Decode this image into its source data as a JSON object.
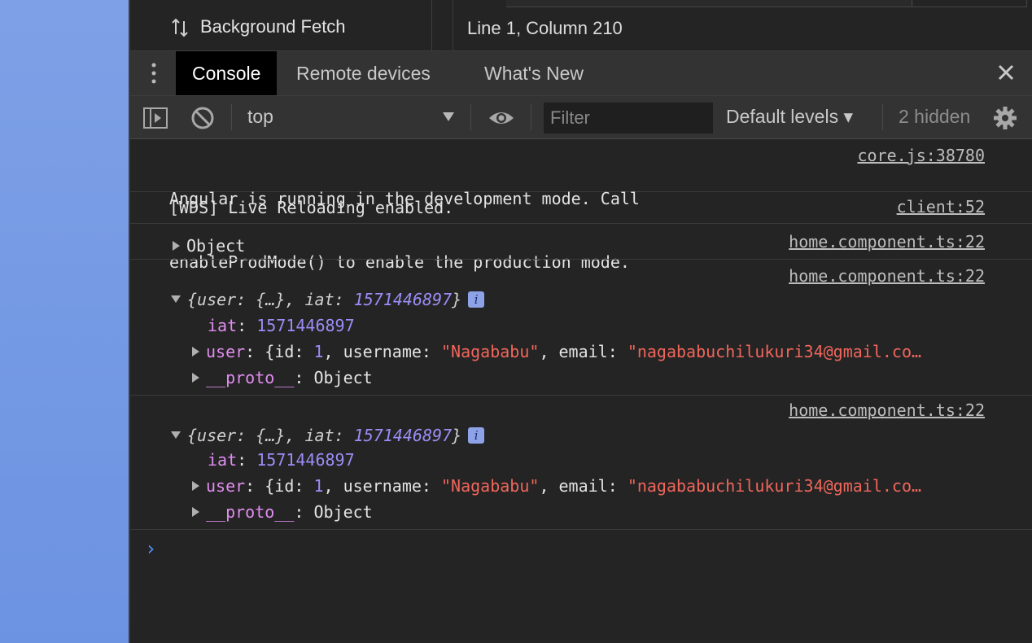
{
  "application_panel": {
    "item_label": "Background Fetch",
    "icon": "up-down-arrows-icon"
  },
  "source_status": "Line 1, Column 210",
  "drawer": {
    "tabs": [
      {
        "label": "Console",
        "active": true
      },
      {
        "label": "Remote devices",
        "active": false
      },
      {
        "label": "What's New",
        "active": false
      }
    ]
  },
  "toolbar": {
    "context": "top",
    "filter_placeholder": "Filter",
    "levels": "Default levels ▾",
    "hidden": "2 hidden"
  },
  "messages": {
    "m1": {
      "line1": "Angular is running in the development mode. Call",
      "line2": "enableProdMode() to enable the production mode.",
      "source": "core.js:38780"
    },
    "m2": {
      "text": "[WDS] Live Reloading enabled.",
      "source": "client:52"
    },
    "m3": {
      "text": "Object",
      "source": "home.component.ts:22"
    },
    "m4": {
      "source": "home.component.ts:22",
      "summary_open": "{user: {…}, iat: ",
      "summary_num": "1571446897",
      "summary_close": "}",
      "iat_key": "iat",
      "iat_val": "1571446897",
      "user_key": "user",
      "user_pre": ": {id: ",
      "user_id": "1",
      "user_mid": ", username: ",
      "username": "\"Nagababu\"",
      "user_mid2": ", email: ",
      "email": "\"nagababuchilukuri34@gmail.co…",
      "proto_key": "__proto__",
      "proto_val": ": Object"
    },
    "m5": {
      "source": "home.component.ts:22",
      "summary_open": "{user: {…}, iat: ",
      "summary_num": "1571446897",
      "summary_close": "}",
      "iat_key": "iat",
      "iat_val": "1571446897",
      "user_key": "user",
      "user_pre": ": {id: ",
      "user_id": "1",
      "user_mid": ", username: ",
      "username": "\"Nagababu\"",
      "user_mid2": ", email: ",
      "email": "\"nagababuchilukuri34@gmail.co…",
      "proto_key": "__proto__",
      "proto_val": ": Object"
    }
  },
  "prompt_symbol": "›",
  "colors": {
    "page_bg_left": "#7ea0e6",
    "console_bg": "#242424",
    "toolbar_bg": "#333333",
    "key": "#e18cf0",
    "number": "#9b8df5",
    "string": "#f0665b",
    "prompt": "#4f8ef7"
  }
}
